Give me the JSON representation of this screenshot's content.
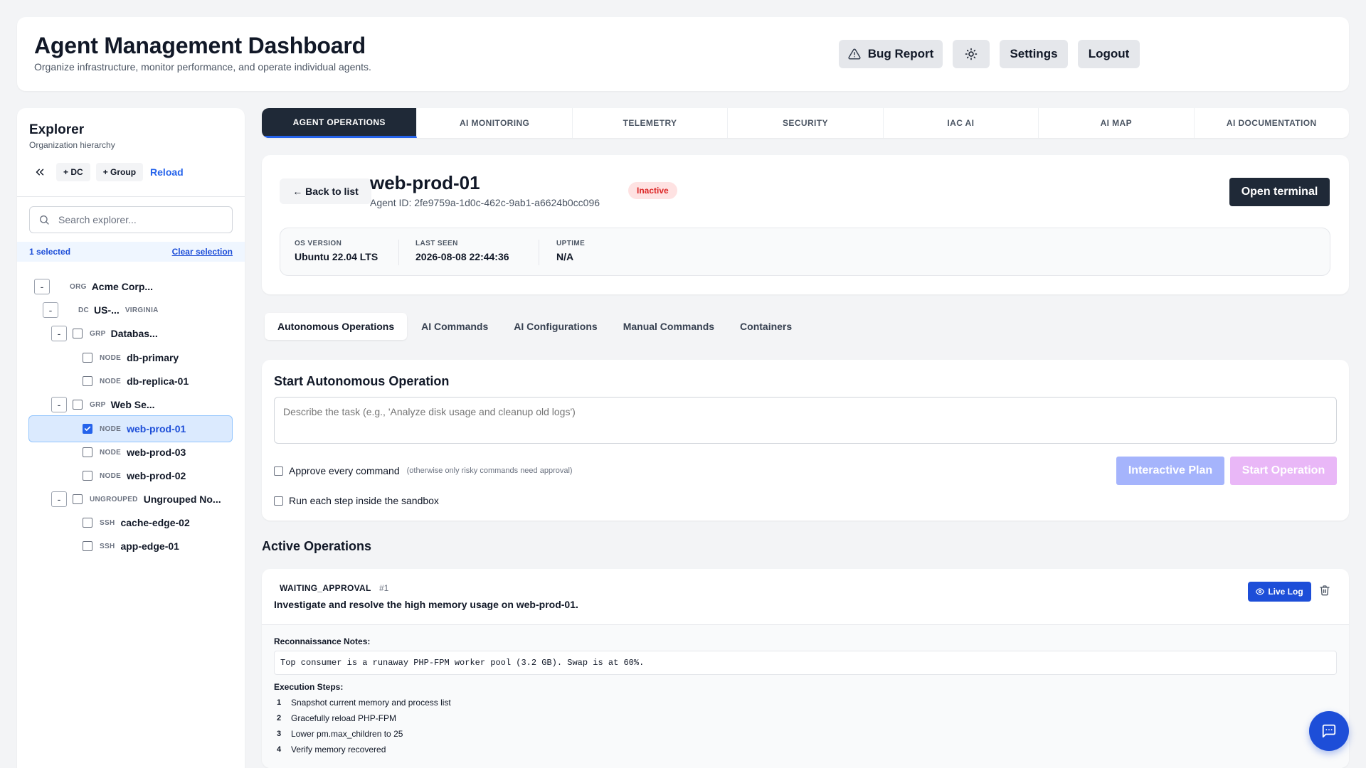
{
  "header": {
    "title": "Agent Management Dashboard",
    "subtitle": "Organize infrastructure, monitor performance, and operate individual agents.",
    "bug_report_label": "Bug Report",
    "settings_label": "Settings",
    "logout_label": "Logout"
  },
  "sidebar": {
    "title": "Explorer",
    "subtitle": "Organization hierarchy",
    "add_dc_label": "+ DC",
    "add_group_label": "+ Group",
    "reload_label": "Reload",
    "search_placeholder": "Search explorer...",
    "selected_text": "1 selected",
    "clear_selection_label": "Clear selection",
    "tree": {
      "org": {
        "toggle": "-",
        "type": "ORG",
        "name": "Acme Corp..."
      },
      "dc": {
        "toggle": "-",
        "type": "DC",
        "name": "US-...",
        "region": "VIRGINIA"
      },
      "grp_db": {
        "toggle": "-",
        "type": "GRP",
        "name": "Databas..."
      },
      "db_primary": {
        "type": "NODE",
        "name": "db-primary"
      },
      "db_replica": {
        "type": "NODE",
        "name": "db-replica-01"
      },
      "grp_web": {
        "toggle": "-",
        "type": "GRP",
        "name": "Web Se..."
      },
      "web_prod_01": {
        "type": "NODE",
        "name": "web-prod-01",
        "selected": true
      },
      "web_prod_03": {
        "type": "NODE",
        "name": "web-prod-03"
      },
      "web_prod_02": {
        "type": "NODE",
        "name": "web-prod-02"
      },
      "ungrouped": {
        "toggle": "-",
        "type": "UNGROUPED",
        "name": "Ungrouped No..."
      },
      "cache_edge": {
        "type": "SSH",
        "name": "cache-edge-02"
      },
      "app_edge": {
        "type": "SSH",
        "name": "app-edge-01"
      }
    }
  },
  "nav_tabs": [
    {
      "label": "AGENT OPERATIONS",
      "active": true
    },
    {
      "label": "AI MONITORING"
    },
    {
      "label": "TELEMETRY"
    },
    {
      "label": "SECURITY"
    },
    {
      "label": "IAC AI"
    },
    {
      "label": "AI MAP"
    },
    {
      "label": "AI DOCUMENTATION"
    }
  ],
  "agent": {
    "back_label": "← Back to list",
    "name": "web-prod-01",
    "id_text": "Agent ID: 2fe9759a-1d0c-462c-9ab1-a6624b0cc096",
    "status": "Inactive",
    "open_terminal_label": "Open terminal",
    "stats": {
      "os_label": "OS VERSION",
      "os_value": "Ubuntu 22.04 LTS",
      "seen_label": "LAST SEEN",
      "seen_value": "2026-08-08 22:44:36",
      "uptime_label": "UPTIME",
      "uptime_value": "N/A"
    }
  },
  "sub_tabs": [
    {
      "label": "Autonomous Operations",
      "active": true
    },
    {
      "label": "AI Commands"
    },
    {
      "label": "AI Configurations"
    },
    {
      "label": "Manual Commands"
    },
    {
      "label": "Containers"
    }
  ],
  "start_op": {
    "title": "Start Autonomous Operation",
    "task_placeholder": "Describe the task (e.g., 'Analyze disk usage and cleanup old logs')",
    "approve_label": "Approve every command",
    "approve_hint": "(otherwise only risky commands need approval)",
    "sandbox_label": "Run each step inside the sandbox",
    "plan_label": "Interactive Plan",
    "start_label": "Start Operation"
  },
  "active_ops": {
    "title": "Active Operations",
    "item": {
      "status": "WAITING_APPROVAL",
      "number": "#1",
      "description": "Investigate and resolve the high memory usage on web-prod-01.",
      "live_log_label": "Live Log",
      "recon_label": "Reconnaissance Notes:",
      "recon_text": "Top consumer is a runaway PHP-FPM worker pool (3.2 GB). Swap is at 60%.",
      "steps_label": "Execution Steps:",
      "steps": [
        {
          "n": "1",
          "text": "Snapshot current memory and process list"
        },
        {
          "n": "2",
          "text": "Gracefully reload PHP-FPM"
        },
        {
          "n": "3",
          "text": "Lower pm.max_children to 25"
        },
        {
          "n": "4",
          "text": "Verify memory recovered"
        }
      ]
    }
  },
  "colors": {
    "accent": "#2563eb",
    "dark": "#1f2937",
    "inactive_bg": "#fee2e2",
    "inactive_fg": "#dc2626",
    "plan_btn": "#a5b4fc",
    "start_btn": "#e9b7f7"
  }
}
